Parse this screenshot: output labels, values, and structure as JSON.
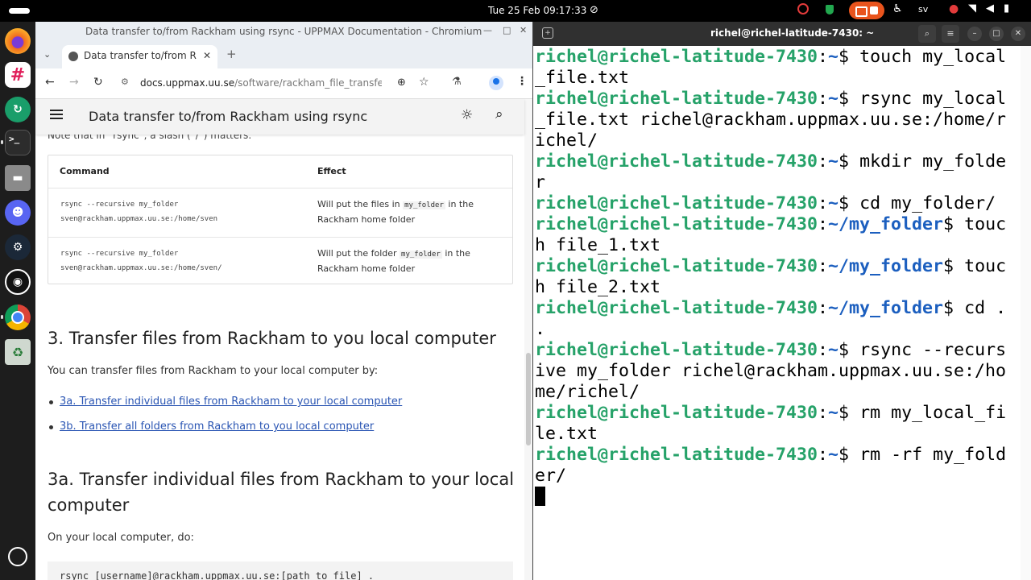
{
  "topbar": {
    "clock": "Tue 25 Feb  09:17:33",
    "lang": "sv",
    "icons": [
      "screen-recorder-icon",
      "shield-icon",
      "screen-share-icon",
      "accessibility-icon",
      "microphone-icon",
      "wifi-icon",
      "volume-icon",
      "battery-icon"
    ]
  },
  "dock": {
    "apps": [
      "firefox",
      "slack",
      "sync",
      "terminal",
      "files",
      "discord",
      "steam",
      "obs",
      "chromium",
      "trash",
      "show-apps"
    ]
  },
  "browser": {
    "window_title": "Data transfer to/from Rackham using rsync - UPPMAX Documentation - Chromium",
    "tab_title": "Data transfer to/from Ra",
    "url_host": "docs.uppmax.uu.se",
    "url_path": "/software/rackham_file_transfer_usi...",
    "doc_title": "Data transfer to/from Rackham using rsync",
    "clipped_note": "Note that in `rsync`, a slash (`/`) matters:",
    "table": {
      "headers": [
        "Command",
        "Effect"
      ],
      "rows": [
        {
          "cmd_line1": "rsync --recursive my_folder",
          "cmd_line2": "sven@rackham.uppmax.uu.se:/home/sven",
          "effect_pre": "Will put the files in ",
          "effect_code": "my_folder",
          "effect_post": " in the",
          "effect_line2": "Rackham home folder"
        },
        {
          "cmd_line1": "rsync --recursive my_folder",
          "cmd_line2": "sven@rackham.uppmax.uu.se:/home/sven/",
          "effect_pre": "Will put the folder ",
          "effect_code": "my_folder",
          "effect_post": " in the",
          "effect_line2": "Rackham home folder"
        }
      ]
    },
    "section3_heading": "3. Transfer files from Rackham to you local computer",
    "section3_intro": "You can transfer files from Rackham to your local computer by:",
    "links": [
      "3a. Transfer individual files from Rackham to your local computer",
      "3b. Transfer all folders from Rackham to you local computer"
    ],
    "section3a_heading_line1": "3a. Transfer individual files from Rackham to your local",
    "section3a_heading_line2": "computer",
    "section3a_intro": "On your local computer, do:",
    "code_snippet": "rsync [username]@rackham.uppmax.uu.se:[path_to_file] ."
  },
  "terminal": {
    "title": "richel@richel-latitude-7430: ~",
    "lines": [
      {
        "user": "richel@richel-latitude-7430",
        "sep": ":",
        "path": "~",
        "prompt": "$ ",
        "cmd": "touch my_local"
      },
      {
        "cont": "_file.txt"
      },
      {
        "user": "richel@richel-latitude-7430",
        "sep": ":",
        "path": "~",
        "prompt": "$ ",
        "cmd": "rsync my_local"
      },
      {
        "cont": "_file.txt richel@rackham.uppmax.uu.se:/home/r"
      },
      {
        "cont": "ichel/"
      },
      {
        "user": "richel@richel-latitude-7430",
        "sep": ":",
        "path": "~",
        "prompt": "$ ",
        "cmd": "mkdir my_folde"
      },
      {
        "cont": "r"
      },
      {
        "user": "richel@richel-latitude-7430",
        "sep": ":",
        "path": "~",
        "prompt": "$ ",
        "cmd": "cd my_folder/"
      },
      {
        "user": "richel@richel-latitude-7430",
        "sep": ":",
        "path": "~/my_folder",
        "prompt": "$ ",
        "cmd": "touc"
      },
      {
        "cont": "h file_1.txt"
      },
      {
        "user": "richel@richel-latitude-7430",
        "sep": ":",
        "path": "~/my_folder",
        "prompt": "$ ",
        "cmd": "touc"
      },
      {
        "cont": "h file_2.txt"
      },
      {
        "user": "richel@richel-latitude-7430",
        "sep": ":",
        "path": "~/my_folder",
        "prompt": "$ ",
        "cmd": "cd ."
      },
      {
        "cont": "."
      },
      {
        "user": "richel@richel-latitude-7430",
        "sep": ":",
        "path": "~",
        "prompt": "$ ",
        "cmd": "rsync --recurs"
      },
      {
        "cont": "ive my_folder richel@rackham.uppmax.uu.se:/ho"
      },
      {
        "cont": "me/richel/"
      },
      {
        "user": "richel@richel-latitude-7430",
        "sep": ":",
        "path": "~",
        "prompt": "$ ",
        "cmd": "rm my_local_fi"
      },
      {
        "cont": "le.txt"
      },
      {
        "user": "richel@richel-latitude-7430",
        "sep": ":",
        "path": "~",
        "prompt": "$ ",
        "cmd": "rm -rf my_fold"
      },
      {
        "cont": "er/"
      }
    ]
  },
  "colors": {
    "prompt_user": "#26a269",
    "prompt_path": "#1c5fbf",
    "link": "#2a55b3",
    "terminal_titlebar": "#303030"
  }
}
